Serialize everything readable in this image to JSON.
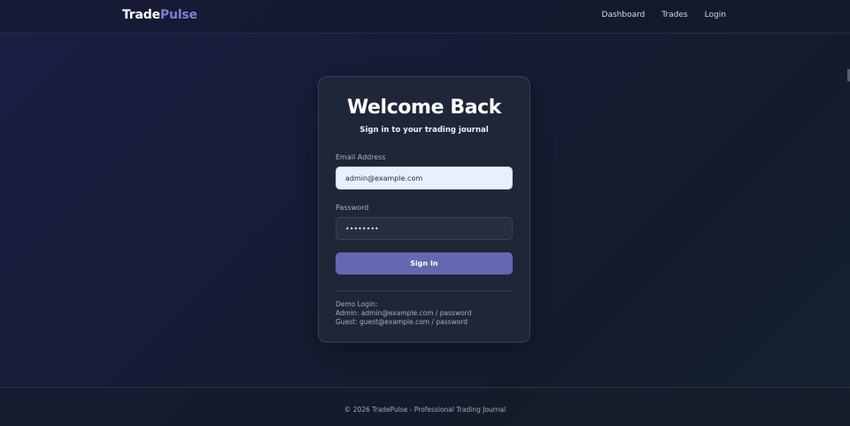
{
  "nav": {
    "brand_part1": "Trade",
    "brand_part2": "Pulse",
    "links": [
      "Dashboard",
      "Trades",
      "Login"
    ]
  },
  "login": {
    "title": "Welcome Back",
    "subtitle": "Sign in to your trading journal",
    "email_label": "Email Address",
    "email_value": "admin@example.com",
    "password_label": "Password",
    "password_value": "password",
    "signin_label": "Sign In",
    "demo_title": "Demo Login:",
    "demo_admin": "Admin: admin@example.com / password",
    "demo_guest": "Guest: guest@example.com / password"
  },
  "footer": {
    "text": "© 2026 TradePulse - Professional Trading Journal"
  },
  "colors": {
    "accent": "#6468b0",
    "brand_accent": "#7c7fd6"
  }
}
